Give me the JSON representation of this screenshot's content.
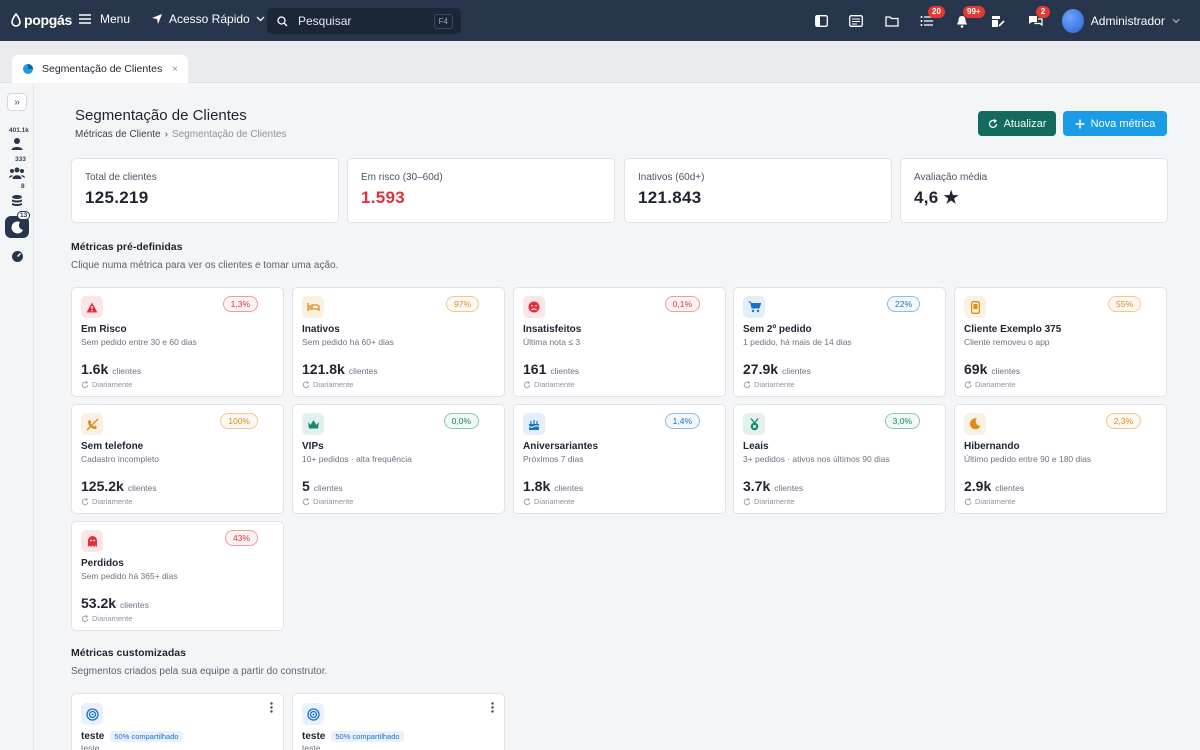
{
  "topbar": {
    "logo": "popgás",
    "menu_label": "Menu",
    "quick_access_label": "Acesso Rápido",
    "search_placeholder": "Pesquisar",
    "search_shortcut": "F4",
    "badges": {
      "tasks": "20",
      "notifications": "99+",
      "chat": "2"
    },
    "user_name": "Administrador"
  },
  "tab": {
    "label": "Segmentação de Clientes",
    "close": "×"
  },
  "rail": {
    "expand": "»",
    "items": [
      {
        "icon": "person-icon",
        "count": "401.1k"
      },
      {
        "icon": "group-icon",
        "count": "333"
      },
      {
        "icon": "coins-icon",
        "count": "8"
      },
      {
        "icon": "moon-icon",
        "count": "13"
      },
      {
        "icon": "gauge-icon",
        "count": ""
      }
    ]
  },
  "page": {
    "title": "Segmentação de Clientes",
    "breadcrumb_parent": "Métricas de Cliente",
    "breadcrumb_sep": "›",
    "breadcrumb_current": "Segmentação de Clientes",
    "refresh_label": "Atualizar",
    "new_metric_label": "Nova métrica"
  },
  "stats": [
    {
      "label": "Total de clientes",
      "value": "125.219"
    },
    {
      "label": "Em risco (30–60d)",
      "value": "1.593"
    },
    {
      "label": "Inativos (60d+)",
      "value": "121.843"
    },
    {
      "label": "Avaliação média",
      "value": "4,6 ★"
    }
  ],
  "predefined": {
    "title": "Métricas pré-definidas",
    "subtitle": "Clique numa métrica para ver os clientes e tomar uma ação.",
    "unit": "clientes",
    "freq": "Diariamente",
    "cards": [
      {
        "title": "Em Risco",
        "desc": "Sem pedido entre 30 e 60 dias",
        "value": "1.6k",
        "pct": "1,3%",
        "icon": "warning-icon",
        "color": "#e0313b"
      },
      {
        "title": "Inativos",
        "desc": "Sem pedido há 60+ dias",
        "value": "121.8k",
        "pct": "97%",
        "icon": "bed-icon",
        "color": "#e08a1a"
      },
      {
        "title": "Insatisfeitos",
        "desc": "Última nota ≤ 3",
        "value": "161",
        "pct": "0,1%",
        "icon": "sad-face-icon",
        "color": "#e0313b"
      },
      {
        "title": "Sem 2º pedido",
        "desc": "1 pedido, há mais de 14 dias",
        "value": "27.9k",
        "pct": "22%",
        "icon": "cart-icon",
        "color": "#1a73c9"
      },
      {
        "title": "Cliente Exemplo 375",
        "desc": "Cliente removeu o app",
        "value": "69k",
        "pct": "55%",
        "icon": "phone-icon",
        "color": "#e08a1a"
      },
      {
        "title": "Sem telefone",
        "desc": "Cadastro incompleto",
        "value": "125.2k",
        "pct": "100%",
        "icon": "no-phone-icon",
        "color": "#e08a1a"
      },
      {
        "title": "VIPs",
        "desc": "10+ pedidos · alta frequência",
        "value": "5",
        "pct": "0,0%",
        "icon": "crown-icon",
        "color": "#138a6e"
      },
      {
        "title": "Aniversariantes",
        "desc": "Próximos 7 dias",
        "value": "1.8k",
        "pct": "1,4%",
        "icon": "cake-icon",
        "color": "#1a73c9"
      },
      {
        "title": "Leais",
        "desc": "3+ pedidos · ativos nos últimos 90 dias",
        "value": "3.7k",
        "pct": "3,0%",
        "icon": "medal-icon",
        "color": "#138a6e"
      },
      {
        "title": "Hibernando",
        "desc": "Último pedido entre 90 e 180 dias",
        "value": "2.9k",
        "pct": "2,3%",
        "icon": "moon-icon",
        "color": "#e08a1a"
      },
      {
        "title": "Perdidos",
        "desc": "Sem pedido há 365+ dias",
        "value": "53.2k",
        "pct": "43%",
        "icon": "ghost-icon",
        "color": "#e0313b"
      }
    ]
  },
  "custom": {
    "title": "Métricas customizadas",
    "subtitle": "Segmentos criados pela sua equipe a partir do construtor.",
    "cards": [
      {
        "title": "teste",
        "tag": "50% compartilhado",
        "desc": "teste"
      },
      {
        "title": "teste",
        "tag": "50% compartilhado",
        "desc": "teste"
      }
    ]
  }
}
